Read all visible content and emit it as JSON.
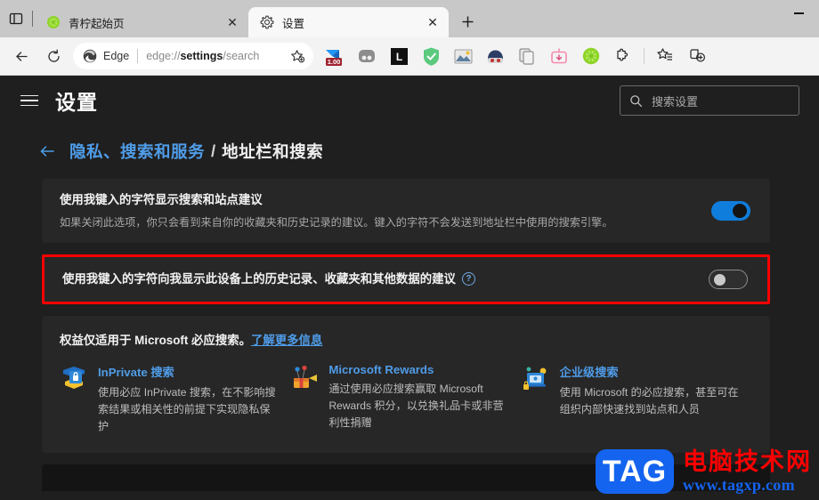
{
  "window": {
    "minimize_label": "−"
  },
  "tabstrip": {
    "tab_actions_icon": "tab-actions-icon",
    "tabs": [
      {
        "title": "青柠起始页",
        "favicon": "lime-circle-icon",
        "close_label": "✕",
        "active": false
      },
      {
        "title": "设置",
        "favicon": "gear-icon",
        "close_label": "✕",
        "active": true
      }
    ],
    "new_tab_label": "+"
  },
  "toolbar": {
    "back_icon": "back-arrow-icon",
    "refresh_icon": "refresh-icon",
    "omnibox": {
      "brand_icon": "edge-logo-icon",
      "brand_text": "Edge",
      "url_prefix": "edge://",
      "url_bold": "settings",
      "url_suffix": "/search",
      "favorite_icon": "add-favorite-icon"
    },
    "extensions": [
      {
        "name": "translate-extension-icon",
        "badge": "1.00"
      },
      {
        "name": "two-dots-extension-icon",
        "badge": ""
      },
      {
        "name": "letter-l-extension-icon",
        "badge": ""
      },
      {
        "name": "green-shield-extension-icon",
        "badge": ""
      },
      {
        "name": "image-extension-icon",
        "badge": ""
      },
      {
        "name": "face-extension-icon",
        "badge": ""
      },
      {
        "name": "copy-pages-extension-icon",
        "badge": ""
      },
      {
        "name": "pink-tv-extension-icon",
        "badge": ""
      },
      {
        "name": "lime-circle-extension-icon",
        "badge": ""
      },
      {
        "name": "puzzle-extensions-icon",
        "badge": ""
      }
    ],
    "collections_icon": "collections-icon",
    "split_screen_icon": "split-screen-icon"
  },
  "settings": {
    "hamburger_icon": "hamburger-menu-icon",
    "title": "设置",
    "search": {
      "icon": "search-icon",
      "placeholder": "搜索设置",
      "value": ""
    },
    "breadcrumb": {
      "back_icon": "back-arrow-icon",
      "parent": "隐私、搜索和服务",
      "separator": "/",
      "current": "地址栏和搜索"
    },
    "rows": [
      {
        "title": "使用我键入的字符显示搜索和站点建议",
        "desc": "如果关闭此选项，你只会看到来自你的收藏夹和历史记录的建议。键入的字符不会发送到地址栏中使用的搜索引擎。",
        "toggle": "on"
      },
      {
        "title": "使用我键入的字符向我显示此设备上的历史记录、收藏夹和其他数据的建议",
        "desc": "",
        "help_icon": "help-question-icon",
        "help_label": "?",
        "toggle": "off",
        "highlighted": true
      }
    ],
    "bing_card": {
      "heading_text": "权益仅适用于 Microsoft 必应搜索。",
      "heading_link": "了解更多信息",
      "features": [
        {
          "icon": "inprivate-lock-icon",
          "title": "InPrivate 搜索",
          "desc": "使用必应 InPrivate 搜索，在不影响搜索结果或相关性的前提下实现隐私保护"
        },
        {
          "icon": "rewards-gift-icon",
          "title": "Microsoft Rewards",
          "desc": "通过使用必应搜索赢取 Microsoft Rewards 积分，以兑换礼品卡或非营利性捐赠"
        },
        {
          "icon": "enterprise-laptop-icon",
          "title": "企业级搜索",
          "desc": "使用 Microsoft 的必应搜索，甚至可在组织内部快速找到站点和人员"
        }
      ]
    }
  },
  "watermark": {
    "logo": "TAG",
    "chinese": "电脑技术网",
    "url": "www.tagxp.com"
  },
  "colors": {
    "accent_blue": "#4f9ce8",
    "toggle_on": "#0f7ddb",
    "highlight_red": "#ff0000",
    "card_bg": "#272727",
    "page_bg": "#1f1f1f"
  }
}
